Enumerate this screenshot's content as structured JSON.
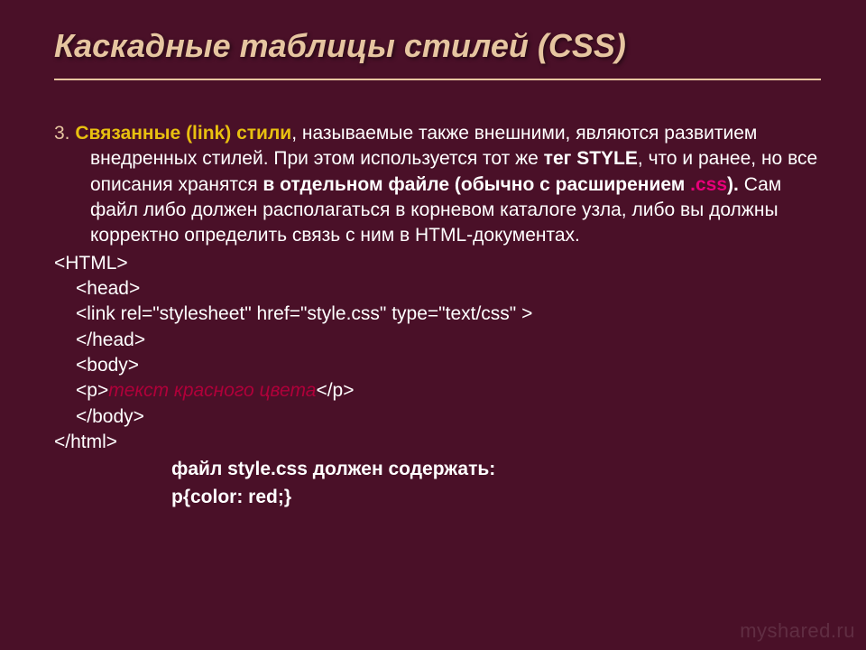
{
  "title": "Каскадные таблицы стилей (CSS)",
  "section_num": "3. ",
  "highlight1": "Связанные (link) стили",
  "text1": ", называемые также внешними, являются развитием внедренных стилей. При этом используется тот же ",
  "bold1": "тег STYLE",
  "text2": ", что и ранее, но все описания хранятся ",
  "bold2": "в отдельном файле (обычно с расширением ",
  "bold_red": ".css",
  "bold3": "). ",
  "text3": "Сам файл либо должен располагаться в корневом каталоге узла, либо вы должны корректно определить связь с ним в HTML-документах.",
  "code": {
    "line1": "<HTML>",
    "line2": "<head>",
    "line3": "<link rel=\"stylesheet\" href=\"style.css\" type=\"text/css\" >",
    "line4": "</head>",
    "line5": "<body>",
    "line6a": "<p>",
    "line6b": "текст красного цвета",
    "line6c": "</p>",
    "line7": "</body>",
    "line8": "</html>"
  },
  "footer1": "файл style.css должен содержать:",
  "footer2": "p{color: red;}",
  "watermark": "myshared.ru"
}
